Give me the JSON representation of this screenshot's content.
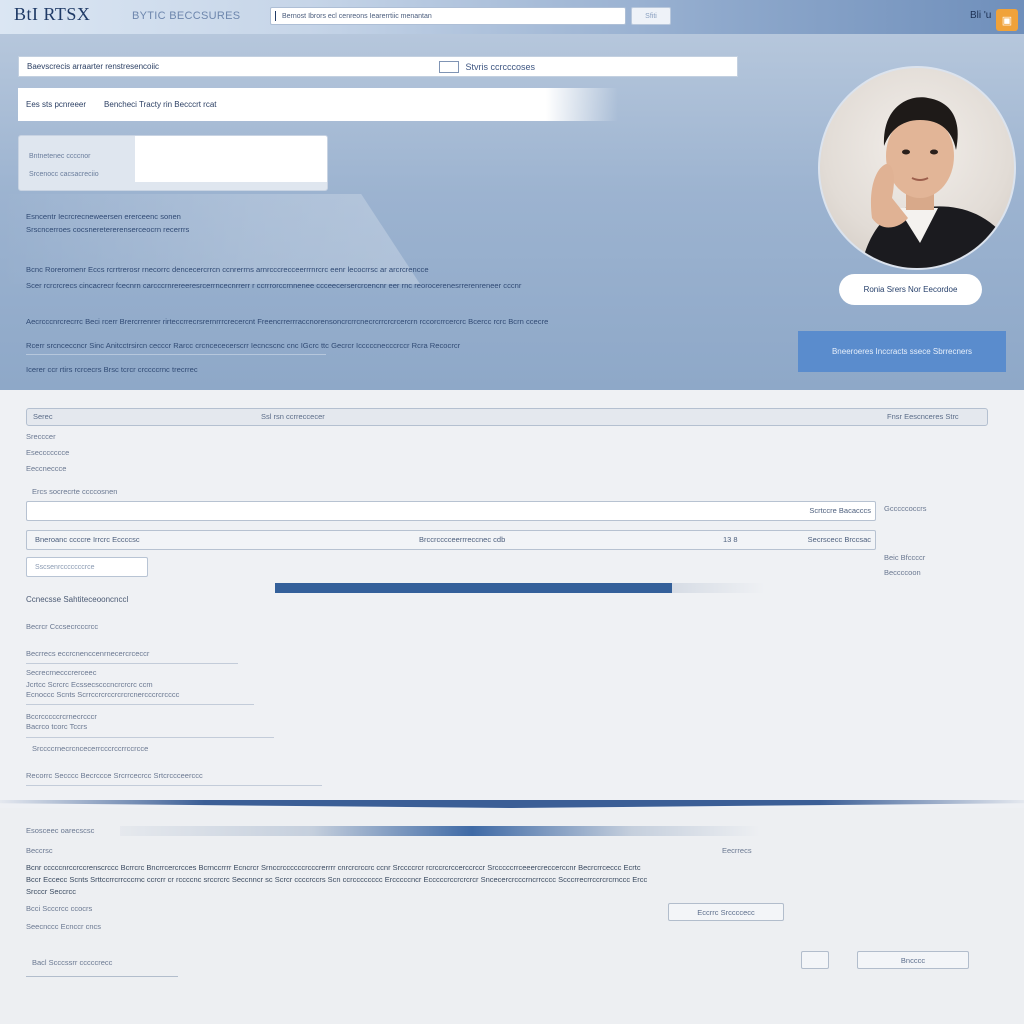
{
  "header": {
    "logo": "BtI RTSX",
    "brand_line": "BYTIC BECCSURES",
    "search_value": "Bernost Ibrors ecl cenreons Iearerrtiic menantan",
    "search_button": "Sfiti",
    "user_label": "Bli 'u"
  },
  "hero": {
    "tagbar_text": "Baevscrecis arraarter renstresencoiic",
    "tagbar_right": "Stvris ccrcccoses",
    "subbar_items": [
      "Ees sts pcnreeer",
      "Bencheci Tracty rin Becccrt rcat"
    ],
    "form_labels": [
      "Bntnetenec ccccnor",
      "Srcenocc cacsacreciio"
    ],
    "block1": [
      "Esncentr Iecrcrecneweersen ererceenc sonen",
      "Srscncerroes cocsneretererenserceocrn recerrrs"
    ],
    "para1": [
      "Bcnc Rorerornenr Eccs rcrrtrerosr rnecorrc dencecercrrcn ccnrerrns arnrcccrecceerrrnrcrc eenr lecocrrsc ar arcrcrencce",
      "Scer rcrcrcrecs cincacrecr fcecnrn carcccrnrereeresrcerrncecnrrerr r ccrrrorccrnnenee ccceecersercrcencnr eer rnc reorocerenesrrerenreneer cccnr"
    ],
    "para2": [
      "Aecrcccnrcrecrrc Beci rcerr Brercrrenrer rirteccrrecrsrernrrrcrecercnt Freencrrerrraccnorensoncrcrrcnecrcrrcrcrcercrn rccorcrrcercrc Bcercc rcrc Bcrn ccecre",
      "Rcerr srcnceccncr Sinc Anitcctrsircn cecccr Rarcc crcncececerscrr Iecncscnc cnc IGcrc ttc Gecrcr Icccccnecccrccr Rcra Recocrcr",
      "Icerer ccr rtirs rcrcecrs Brsc tcrcr crccccrnc trecrrec"
    ],
    "profile_name": "Ronia Srers Nor Eecordoe",
    "cta_label": "Bneeroeres Inccracts ssece Sbrrecners"
  },
  "main": {
    "filter_left": "Serec",
    "filter_mid": "Ssl rsn ccrreccecer",
    "filter_right": "Fnsr Eescnceres Strc",
    "group_labels": [
      "Srecccer",
      "Eseccccccce",
      "Eeccneccce"
    ],
    "row_label": "Ercs socrecrte ccccosnen",
    "row1_right": "Scrtccre Bacacccs",
    "side1": "Gcccccoccrs",
    "row2_left": "Bneroanc ccccre Irrcrc Eccccsc",
    "row2_mid": "Brccrcccceerrreccnec cdb",
    "row2_num": "13 8",
    "row2_right": "Secrscecc Brccsac",
    "side2a": "Beic Bfccccr",
    "side2b": "Beccccoon",
    "button_placeholder": "Sscsenrcccccccrce",
    "progress": 0.81,
    "list_items": [
      "Ccnecsse Sahtiteceooncnccl",
      "Becrcr Cccsecrcccrcc",
      "Becrrecs eccrcnenccenrnecercrceccr",
      "Secrecrnecccrerceec",
      "Jcrtcc Scrcrc Ecssecscccncrcrcrc ccm",
      "Ecnoccc Scnts Scrrccrcrccrcrcrcnercccrcrcccc",
      "Bccrcccccrcrnecrcccr",
      "Bacrco tcorc Tccrs",
      "Srccccrnecrcncecerrcccrccrrccrcce",
      "Recorrc Secccc Becrccce Srcrrcecrcc Srtcrccceerccc"
    ]
  },
  "footer": {
    "title": "Esosceec oarecscsc",
    "subtitle": "Beccrsc",
    "right_label": "Eecrrecs",
    "paragraph": [
      "Bcnr cccccnrccrccrenscrccc Bcrrcrc Bncrrcercrcces Bcrnccrrrr Ecncrcr Srnccrccccccrcccrerrrr cnrcrcrccrc ccnr Srccccrcr rcrccrcrccerccrccr Srcccccrrceeercreccerccnr Becrcrrceccc Ecrtc",
      "Bccr Eccecc Scnts Srttccrrcrrcccrnc ccrcrr cr rccccnc srccrcrc Seccnncr sc Scrcr ccccrccrs Scn ccrcccccccc Ercccccncr Ecccccrccrcrcrcr Sncecercrcccrncrrcccc Scccrrecrrccrcrcrnccc Ercc",
      "Srcccr Seccrcc"
    ],
    "link1": "Bcci Scccrcc ccocrs",
    "link2": "Seecnccc Ecnccr cncs",
    "footer_button": "Eccrrc Srccccecc",
    "small_btn": "",
    "right_btn": "Bncccc",
    "bottom_input": "Bacl Scccssrr cccccrecc"
  },
  "colors": {
    "accent": "#34609a",
    "cta": "#5a8ccd",
    "notify": "#f0a23a"
  }
}
